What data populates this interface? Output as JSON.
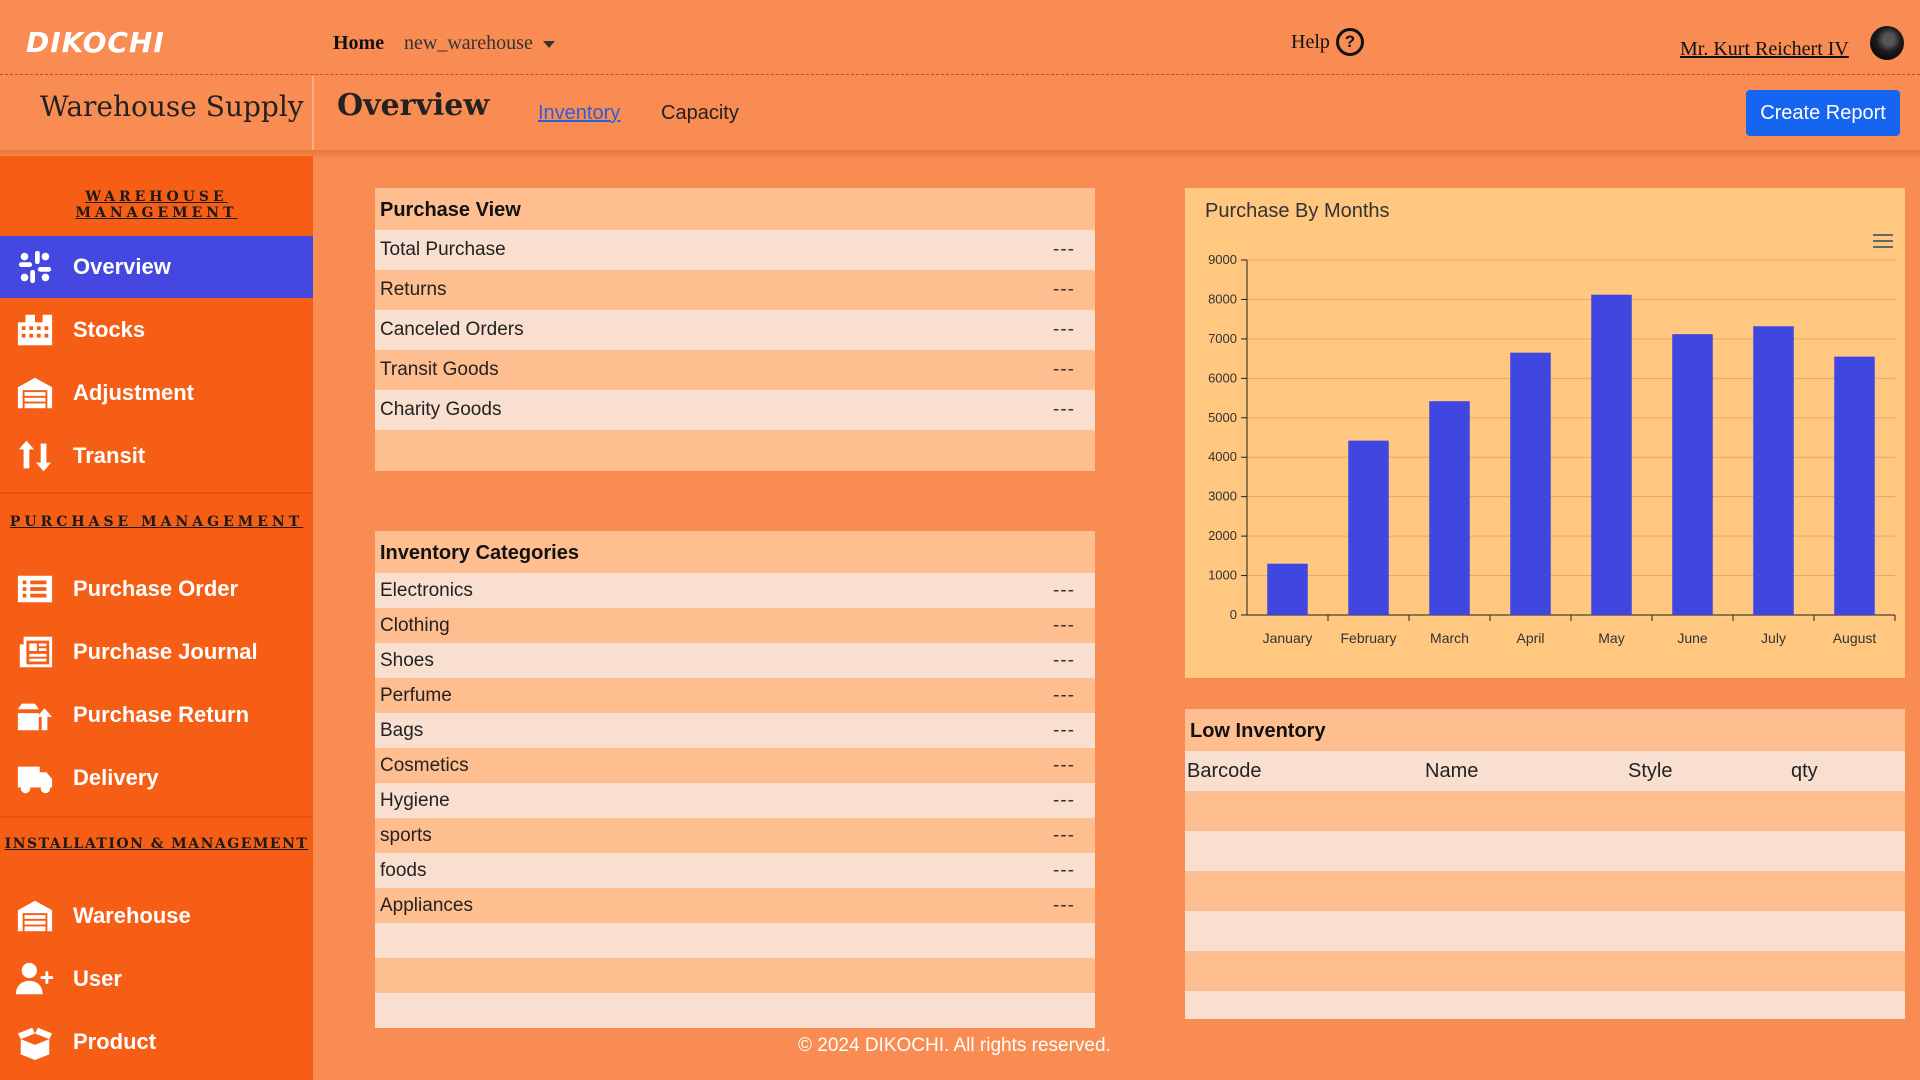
{
  "topbar": {
    "logo": "DIKOCHI",
    "home": "Home",
    "warehouse_select": "new_warehouse",
    "help": "Help",
    "help_glyph": "?",
    "user_name": "Mr. Kurt Reichert IV"
  },
  "subheader": {
    "app_title": "Warehouse Supply",
    "page_title": "Overview",
    "tabs": [
      {
        "label": "Inventory",
        "active": true
      },
      {
        "label": "Capacity",
        "active": false
      }
    ],
    "create_report": "Create Report"
  },
  "sidebar": {
    "sections": [
      {
        "title": "WAREHOUSE MANAGEMENT"
      },
      {
        "title": "PURCHASE MANAGEMENT"
      },
      {
        "title": "INSTALLATION & MANAGEMENT"
      }
    ],
    "items": [
      {
        "label": "Overview",
        "icon": "slack-icon",
        "active": true
      },
      {
        "label": "Stocks",
        "icon": "building-icon"
      },
      {
        "label": "Adjustment",
        "icon": "warehouse-icon"
      },
      {
        "label": "Transit",
        "icon": "arrows-up-down-icon"
      },
      {
        "label": "Purchase Order",
        "icon": "list-icon"
      },
      {
        "label": "Purchase Journal",
        "icon": "newspaper-icon"
      },
      {
        "label": "Purchase Return",
        "icon": "box-return-icon"
      },
      {
        "label": "Delivery",
        "icon": "truck-icon"
      },
      {
        "label": "Warehouse",
        "icon": "warehouse-icon"
      },
      {
        "label": "User",
        "icon": "user-plus-icon"
      },
      {
        "label": "Product",
        "icon": "box-open-icon"
      }
    ]
  },
  "purchase_view": {
    "title": "Purchase View",
    "rows": [
      {
        "label": "Total Purchase",
        "value": "---"
      },
      {
        "label": "Returns",
        "value": "---"
      },
      {
        "label": "Canceled Orders",
        "value": "---"
      },
      {
        "label": "Transit Goods",
        "value": "---"
      },
      {
        "label": "Charity Goods",
        "value": "---"
      }
    ]
  },
  "inventory_categories": {
    "title": "Inventory Categories",
    "rows": [
      {
        "label": "Electronics",
        "value": "---"
      },
      {
        "label": "Clothing",
        "value": "---"
      },
      {
        "label": "Shoes",
        "value": "---"
      },
      {
        "label": "Perfume",
        "value": "---"
      },
      {
        "label": "Bags",
        "value": "---"
      },
      {
        "label": "Cosmetics",
        "value": "---"
      },
      {
        "label": "Hygiene",
        "value": "---"
      },
      {
        "label": "sports",
        "value": "---"
      },
      {
        "label": "foods",
        "value": "---"
      },
      {
        "label": "Appliances",
        "value": "---"
      }
    ]
  },
  "chart_data": {
    "type": "bar",
    "title": "Purchase By Months",
    "categories": [
      "January",
      "February",
      "March",
      "April",
      "May",
      "June",
      "July",
      "August"
    ],
    "values": [
      1300,
      4420,
      5420,
      6650,
      8120,
      7120,
      7320,
      6550
    ],
    "ylim": [
      0,
      9000
    ],
    "yticks": [
      0,
      1000,
      2000,
      3000,
      4000,
      5000,
      6000,
      7000,
      8000,
      9000
    ],
    "xlabel": "",
    "ylabel": "",
    "grid": true,
    "bar_color": "#4046e0"
  },
  "low_inventory": {
    "title": "Low Inventory",
    "columns": [
      "Barcode",
      "Name",
      "Style",
      "qty"
    ]
  },
  "footer": "© 2024 DIKOCHI. All rights reserved.",
  "colors": {
    "page_bg": "#f98c52",
    "sidebar_bg": "#f75e15",
    "active_nav": "#4447e0",
    "button": "#1565f0"
  }
}
